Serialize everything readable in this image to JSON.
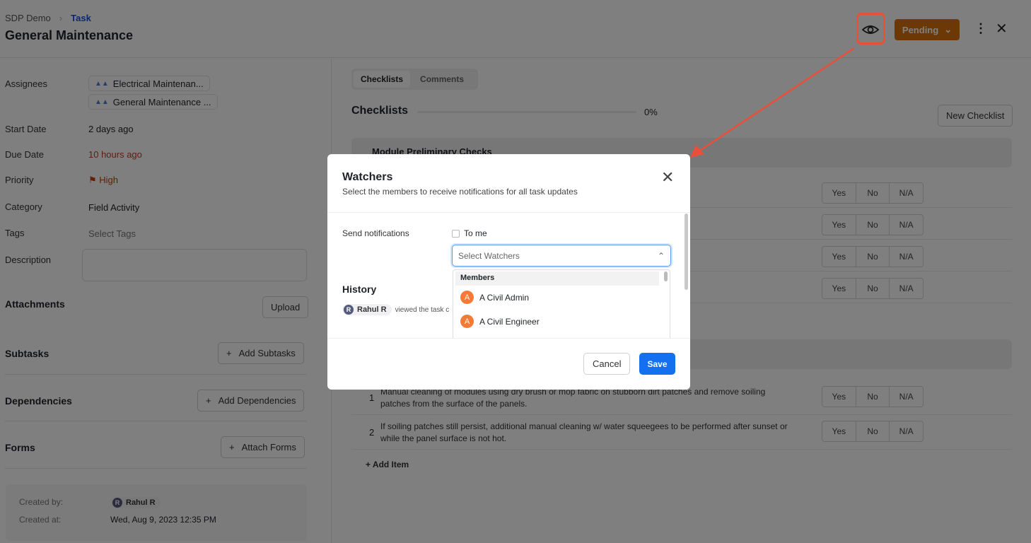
{
  "header": {
    "breadcrumb": [
      "SDP Demo",
      "Task"
    ],
    "title": "General Maintenance",
    "status": "Pending",
    "status_color": "#d9730d"
  },
  "details": {
    "assignees_label": "Assignees",
    "assignees": [
      "Electrical Maintenan...",
      "General Maintenance ..."
    ],
    "start_label": "Start Date",
    "start": "2 days ago",
    "due_label": "Due Date",
    "due": "10 hours ago",
    "due_color": "#c0392b",
    "priority_label": "Priority",
    "priority": "High",
    "priority_color": "#c2410c",
    "category_label": "Category",
    "category": "Field Activity",
    "tags_label": "Tags",
    "tags_placeholder": "Select Tags",
    "description_label": "Description"
  },
  "sections": {
    "attachments": "Attachments",
    "upload": "Upload",
    "subtasks": "Subtasks",
    "add_subtasks": "Add Subtasks",
    "dependencies": "Dependencies",
    "add_dependencies": "Add Dependencies",
    "forms": "Forms",
    "attach_forms": "Attach Forms"
  },
  "meta": {
    "created_by_label": "Created by:",
    "created_by": "Rahul R",
    "created_by_initial": "R",
    "created_at_label": "Created at:",
    "created_at": "Wed, Aug 9, 2023 12:35 PM"
  },
  "main": {
    "tabs": [
      "Checklists",
      "Comments"
    ],
    "heading": "Checklists",
    "progress": "0%",
    "progress_value": 0,
    "new_checklist": "New Checklist",
    "group1": "Module Preliminary Checks",
    "options": [
      "Yes",
      "No",
      "N/A"
    ],
    "items": [
      {
        "num": "1",
        "text": "Manual cleaning of modules using dry brush or mop fabric on stubborn dirt patches and remove soiling patches from the surface of the panels."
      },
      {
        "num": "2",
        "text": "If soiling patches still persist, additional manual cleaning w/ water squeegees to be performed after sunset or while the panel surface is not hot."
      }
    ],
    "add_item": "+ Add Item"
  },
  "modal": {
    "title": "Watchers",
    "subtitle": "Select the members to receive notifications for all task updates",
    "send_label": "Send notifications",
    "to_me": "To me",
    "to_me_checked": false,
    "select_placeholder": "Select Watchers",
    "group": "Members",
    "members": [
      {
        "initial": "A",
        "name": "A Civil Admin"
      },
      {
        "initial": "A",
        "name": "A Civil Engineer"
      }
    ],
    "history": "History",
    "history_user": "Rahul R",
    "history_initial": "R",
    "history_text": "viewed the task c",
    "cancel": "Cancel",
    "save": "Save",
    "save_color": "#1570ef"
  },
  "annotation_color": "#e8503a"
}
